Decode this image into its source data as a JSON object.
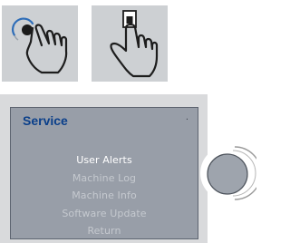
{
  "gestures": [
    {
      "icon": "rotate-gesture-icon"
    },
    {
      "icon": "press-gesture-icon"
    }
  ],
  "screen": {
    "title": "Service",
    "indicator": ".",
    "menu": [
      {
        "label": "User Alerts",
        "selected": true
      },
      {
        "label": "Machine Log",
        "selected": false
      },
      {
        "label": "Machine Info",
        "selected": false
      },
      {
        "label": "Software Update",
        "selected": false
      },
      {
        "label": "Return",
        "selected": false
      }
    ]
  },
  "control_knob": {
    "icon": "rotary-knob-icon"
  },
  "colors": {
    "tile_background": "#cdd0d3",
    "screen_background": "#989ea8",
    "title": "#0a3f8a",
    "menu_selected": "#ffffff",
    "menu_normal": "#c5c9cf"
  }
}
